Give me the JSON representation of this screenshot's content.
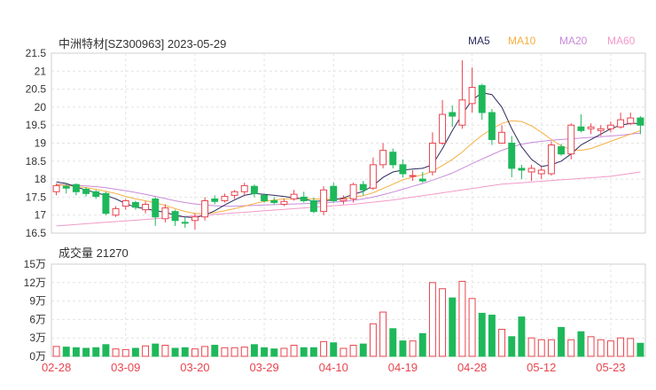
{
  "chart_data": {
    "type": "candlestick",
    "title": "中洲特材[SZ300963] 2023-05-29",
    "legend": [
      {
        "name": "MA5",
        "color": "#2b2b5e"
      },
      {
        "name": "MA10",
        "color": "#f5b041"
      },
      {
        "name": "MA20",
        "color": "#c98bd9"
      },
      {
        "name": "MA60",
        "color": "#f29ac9"
      }
    ],
    "price_axis": {
      "ticks": [
        "21.5",
        "21",
        "20.5",
        "20",
        "19.5",
        "19",
        "18.5",
        "18",
        "17.5",
        "17",
        "16.5"
      ],
      "ylim": [
        16.5,
        21.5
      ]
    },
    "volume_label": "成交量 21270",
    "volume_axis": {
      "ticks": [
        "15万",
        "12万",
        "9万",
        "6万",
        "3万",
        "0万"
      ],
      "ylim": [
        0,
        150000
      ]
    },
    "x_labels": [
      {
        "label": "02-28",
        "index": 0
      },
      {
        "label": "03-09",
        "index": 7
      },
      {
        "label": "03-20",
        "index": 14
      },
      {
        "label": "03-29",
        "index": 21
      },
      {
        "label": "04-10",
        "index": 28
      },
      {
        "label": "04-19",
        "index": 35
      },
      {
        "label": "04-28",
        "index": 42
      },
      {
        "label": "05-12",
        "index": 49
      },
      {
        "label": "05-23",
        "index": 56
      }
    ],
    "colors": {
      "up": "#e8454f",
      "down": "#1eb85a"
    },
    "candles": [
      [
        17.65,
        17.82,
        17.88,
        17.55
      ],
      [
        17.8,
        17.75,
        17.9,
        17.6
      ],
      [
        17.85,
        17.65,
        17.88,
        17.55
      ],
      [
        17.72,
        17.6,
        17.78,
        17.52
      ],
      [
        17.65,
        17.52,
        17.7,
        17.45
      ],
      [
        17.6,
        17.05,
        17.65,
        17.0
      ],
      [
        17.0,
        17.18,
        17.25,
        16.95
      ],
      [
        17.25,
        17.4,
        17.45,
        17.15
      ],
      [
        17.35,
        17.22,
        17.4,
        17.15
      ],
      [
        17.15,
        17.3,
        17.38,
        17.05
      ],
      [
        17.45,
        16.95,
        17.5,
        16.7
      ],
      [
        16.9,
        17.2,
        17.3,
        16.8
      ],
      [
        17.1,
        16.85,
        17.15,
        16.7
      ],
      [
        16.8,
        16.78,
        16.95,
        16.65
      ],
      [
        16.85,
        16.95,
        17.05,
        16.6
      ],
      [
        16.95,
        17.4,
        17.5,
        16.85
      ],
      [
        17.45,
        17.38,
        17.55,
        17.3
      ],
      [
        17.4,
        17.52,
        17.6,
        17.35
      ],
      [
        17.55,
        17.65,
        17.7,
        17.45
      ],
      [
        17.65,
        17.82,
        17.9,
        17.55
      ],
      [
        17.8,
        17.6,
        17.85,
        17.5
      ],
      [
        17.55,
        17.4,
        17.6,
        17.35
      ],
      [
        17.4,
        17.35,
        17.5,
        17.3
      ],
      [
        17.3,
        17.38,
        17.45,
        17.25
      ],
      [
        17.45,
        17.58,
        17.7,
        17.4
      ],
      [
        17.5,
        17.4,
        17.65,
        17.35
      ],
      [
        17.4,
        17.1,
        17.48,
        17.05
      ],
      [
        17.1,
        17.7,
        17.8,
        17.0
      ],
      [
        17.8,
        17.4,
        17.9,
        17.35
      ],
      [
        17.4,
        17.45,
        17.55,
        17.3
      ],
      [
        17.45,
        17.85,
        17.9,
        17.35
      ],
      [
        17.85,
        17.7,
        17.95,
        17.55
      ],
      [
        17.75,
        18.4,
        18.6,
        17.7
      ],
      [
        18.4,
        18.8,
        19.0,
        18.3
      ],
      [
        18.75,
        18.4,
        18.85,
        18.3
      ],
      [
        18.4,
        18.15,
        18.55,
        18.05
      ],
      [
        18.1,
        18.1,
        18.25,
        17.95
      ],
      [
        18.0,
        17.95,
        18.2,
        17.9
      ],
      [
        18.2,
        19.0,
        19.3,
        18.1
      ],
      [
        19.0,
        19.8,
        20.2,
        18.95
      ],
      [
        19.85,
        19.75,
        20.05,
        19.45
      ],
      [
        19.5,
        20.2,
        21.3,
        19.4
      ],
      [
        20.1,
        20.55,
        21.1,
        19.85
      ],
      [
        20.6,
        19.85,
        20.65,
        19.65
      ],
      [
        19.85,
        19.1,
        19.95,
        18.95
      ],
      [
        19.0,
        19.3,
        19.5,
        19.0
      ],
      [
        19.0,
        18.3,
        19.2,
        18.05
      ],
      [
        18.3,
        18.25,
        18.4,
        18.0
      ],
      [
        18.2,
        18.3,
        18.4,
        17.95
      ],
      [
        18.15,
        18.25,
        18.35,
        18.0
      ],
      [
        18.15,
        18.95,
        19.05,
        18.1
      ],
      [
        18.9,
        18.7,
        18.98,
        18.65
      ],
      [
        18.7,
        19.5,
        19.55,
        18.55
      ],
      [
        19.45,
        19.35,
        19.8,
        19.3
      ],
      [
        19.4,
        19.45,
        19.55,
        19.25
      ],
      [
        19.35,
        19.4,
        19.5,
        19.2
      ],
      [
        19.4,
        19.5,
        19.6,
        19.3
      ],
      [
        19.45,
        19.65,
        19.85,
        19.4
      ],
      [
        19.55,
        19.7,
        19.85,
        19.5
      ],
      [
        19.7,
        19.5,
        19.75,
        19.25
      ]
    ],
    "ma5": [
      17.92,
      17.88,
      17.78,
      17.7,
      17.62,
      17.55,
      17.45,
      17.32,
      17.22,
      17.18,
      17.12,
      17.08,
      17.0,
      16.95,
      16.93,
      17.0,
      17.12,
      17.28,
      17.42,
      17.55,
      17.6,
      17.58,
      17.55,
      17.52,
      17.48,
      17.45,
      17.38,
      17.4,
      17.42,
      17.48,
      17.58,
      17.66,
      17.82,
      18.05,
      18.2,
      18.25,
      18.28,
      18.3,
      18.4,
      18.85,
      19.35,
      19.8,
      20.2,
      20.4,
      20.35,
      20.0,
      19.4,
      18.9,
      18.55,
      18.35,
      18.4,
      18.5,
      18.7,
      18.95,
      19.1,
      19.25,
      19.4,
      19.5,
      19.55,
      19.55
    ],
    "ma10": [
      17.85,
      17.82,
      17.8,
      17.76,
      17.72,
      17.66,
      17.6,
      17.52,
      17.45,
      17.4,
      17.34,
      17.27,
      17.18,
      17.1,
      17.05,
      17.04,
      17.07,
      17.12,
      17.18,
      17.25,
      17.32,
      17.38,
      17.42,
      17.45,
      17.46,
      17.46,
      17.45,
      17.44,
      17.44,
      17.46,
      17.5,
      17.54,
      17.62,
      17.74,
      17.86,
      17.98,
      18.06,
      18.12,
      18.22,
      18.38,
      18.55,
      18.75,
      19.0,
      19.22,
      19.4,
      19.55,
      19.62,
      19.6,
      19.48,
      19.3,
      19.1,
      18.92,
      18.82,
      18.8,
      18.85,
      18.95,
      19.05,
      19.15,
      19.25,
      19.35
    ],
    "ma20": [
      17.86,
      17.85,
      17.83,
      17.81,
      17.79,
      17.76,
      17.72,
      17.68,
      17.63,
      17.58,
      17.52,
      17.46,
      17.4,
      17.35,
      17.31,
      17.28,
      17.26,
      17.25,
      17.25,
      17.26,
      17.27,
      17.28,
      17.29,
      17.3,
      17.31,
      17.32,
      17.33,
      17.34,
      17.36,
      17.38,
      17.41,
      17.45,
      17.5,
      17.57,
      17.64,
      17.72,
      17.8,
      17.88,
      17.97,
      18.07,
      18.17,
      18.3,
      18.43,
      18.56,
      18.68,
      18.8,
      18.9,
      18.97,
      19.02,
      19.05,
      19.08,
      19.1,
      19.12,
      19.14,
      19.16,
      19.18,
      19.2,
      19.22,
      19.25,
      19.28
    ],
    "ma60": [
      16.7,
      16.72,
      16.74,
      16.76,
      16.78,
      16.8,
      16.82,
      16.84,
      16.86,
      16.88,
      16.9,
      16.92,
      16.94,
      16.96,
      16.98,
      17.0,
      17.02,
      17.04,
      17.06,
      17.08,
      17.1,
      17.12,
      17.14,
      17.16,
      17.18,
      17.2,
      17.22,
      17.24,
      17.26,
      17.28,
      17.3,
      17.33,
      17.36,
      17.39,
      17.42,
      17.46,
      17.5,
      17.54,
      17.58,
      17.62,
      17.66,
      17.7,
      17.74,
      17.78,
      17.82,
      17.86,
      17.88,
      17.9,
      17.92,
      17.94,
      17.96,
      17.98,
      18.0,
      18.02,
      18.04,
      18.06,
      18.08,
      18.12,
      18.16,
      18.2
    ],
    "volume": [
      16000,
      15000,
      14000,
      13000,
      14000,
      19000,
      12000,
      11000,
      13000,
      17000,
      20000,
      18000,
      13000,
      14000,
      12000,
      16000,
      18000,
      14000,
      14000,
      15000,
      19000,
      14000,
      12000,
      13000,
      18000,
      14000,
      14000,
      24000,
      22000,
      13000,
      18000,
      20000,
      53000,
      72000,
      45000,
      25000,
      25000,
      37000,
      120000,
      110000,
      95000,
      122000,
      94000,
      70000,
      67000,
      44000,
      32000,
      64000,
      30000,
      27000,
      27000,
      47000,
      27000,
      40000,
      32000,
      27000,
      25000,
      30000,
      29000,
      21270
    ]
  }
}
